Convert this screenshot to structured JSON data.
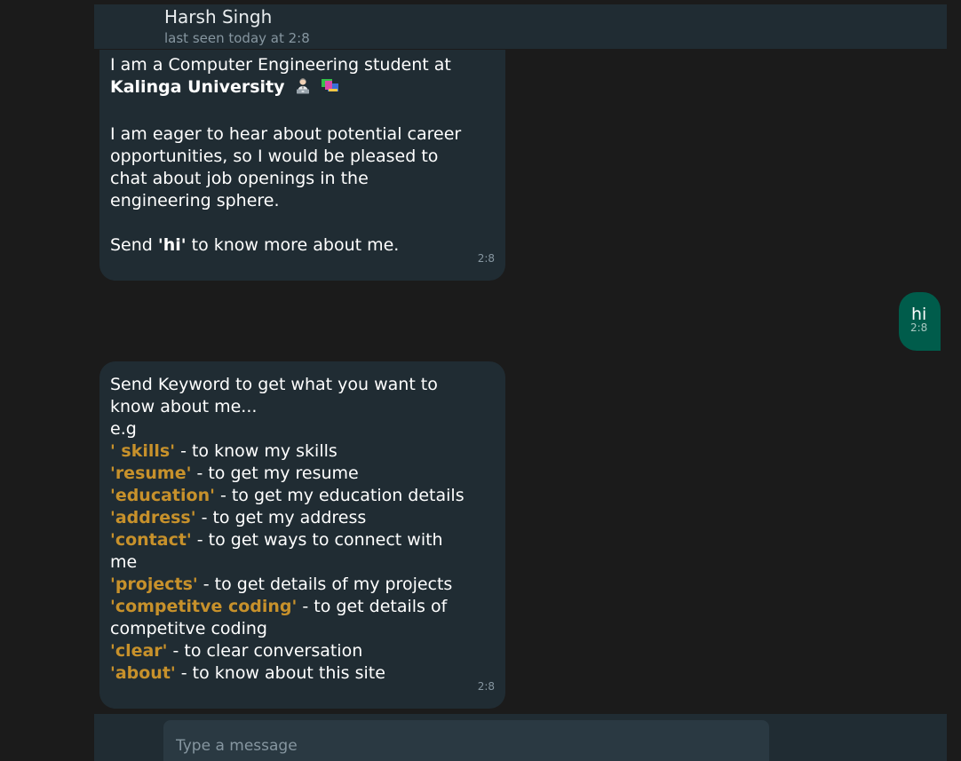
{
  "header": {
    "contact_name": "Harsh Singh",
    "last_seen": "last seen today at 2:8"
  },
  "messages": [
    {
      "direction": "incoming",
      "intro_text": "I am a Computer Engineering student at",
      "university": "Kalinga University",
      "line2_a": "I am eager to hear about potential career",
      "line2_b": "opportunities, so I would be pleased to",
      "line2_c": "chat about job openings in the",
      "line2_d": "engineering sphere.",
      "send_prefix": "Send ",
      "send_keyword": "'hi'",
      "send_suffix": " to know more about me.",
      "time": "2:8"
    },
    {
      "direction": "outgoing",
      "text": "hi",
      "time": "2:8"
    },
    {
      "direction": "incoming",
      "line_a": "Send Keyword to get what you want to",
      "line_b": "know about me...",
      "example": "e.g",
      "keywords": [
        {
          "kw": "' skills'",
          "desc": " - to know my skills"
        },
        {
          "kw": "'resume'",
          "desc": " - to get my resume"
        },
        {
          "kw": "'education'",
          "desc": " - to get my education details"
        },
        {
          "kw": "'address'",
          "desc": " - to get my address"
        },
        {
          "kw": "'contact'",
          "desc": " - to get ways to connect with",
          "desc_cont": "me"
        },
        {
          "kw": "'projects'",
          "desc": " - to get details of my projects"
        },
        {
          "kw": "'competitve coding'",
          "desc": " - to get details of",
          "desc_cont": "competitve coding"
        },
        {
          "kw": "'clear'",
          "desc": " - to clear conversation"
        },
        {
          "kw": "'about'",
          "desc": " - to know about this site"
        }
      ],
      "time": "2:8"
    }
  ],
  "composer": {
    "placeholder": "Type a message"
  },
  "icons": {
    "technologist": "technologist-icon",
    "books": "books-icon"
  },
  "colors": {
    "background": "#1b1b1b",
    "panel": "#202c33",
    "incoming_bubble": "#202c33",
    "outgoing_bubble": "#005c4b",
    "keyword": "#c7912b",
    "muted_text": "#8696a0"
  }
}
